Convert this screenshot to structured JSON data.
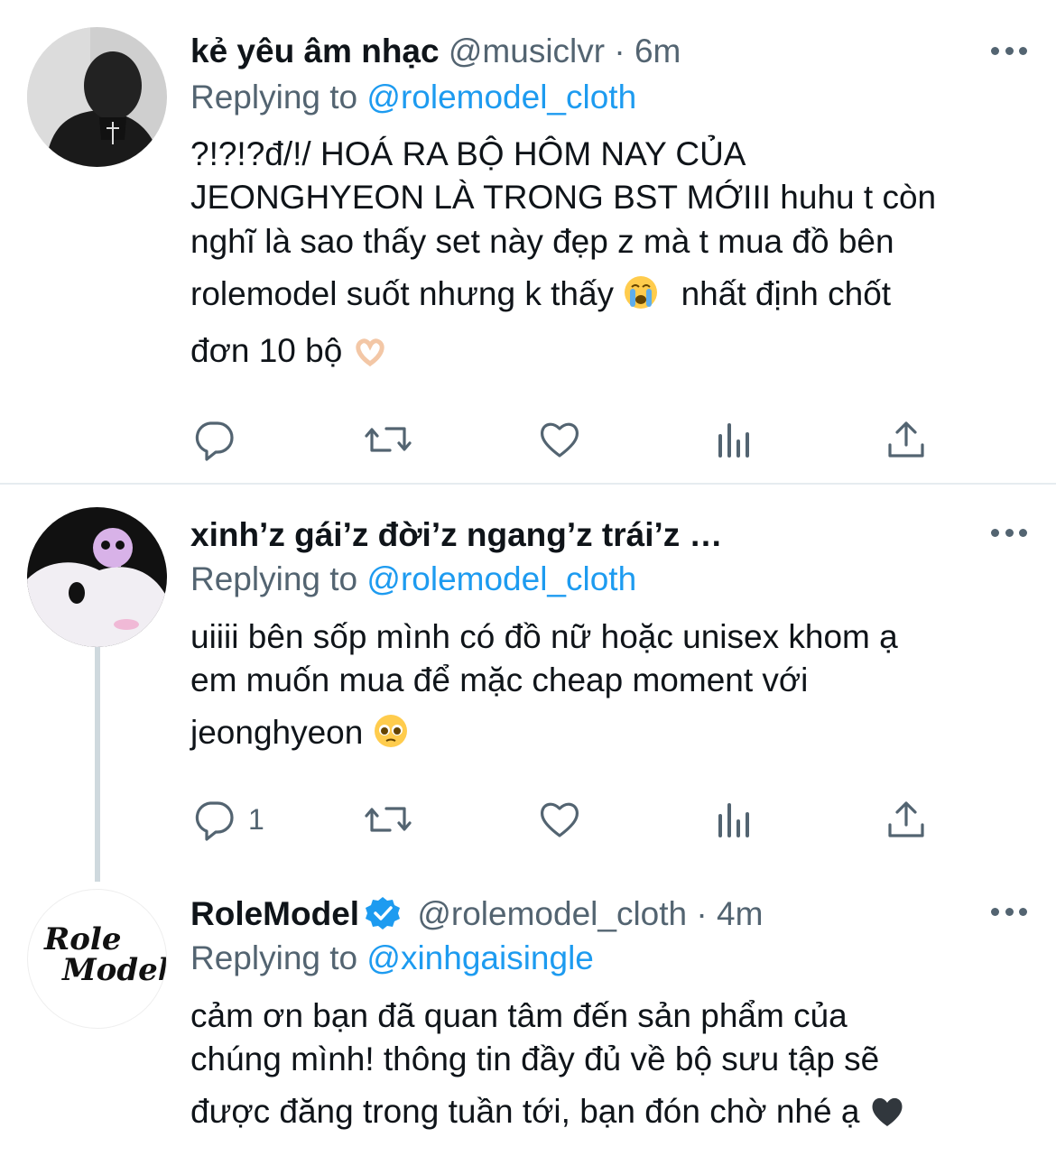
{
  "tweets": [
    {
      "name": "kẻ yêu âm nhạc",
      "handle": "@musiclvr · 6m",
      "replying_prefix": "Replying to",
      "replying_to": "@rolemodel_cloth",
      "lines": [
        "?!?!?đ/!/ HOÁ RA BỘ HÔM NAY CỦA",
        "JEONGHYEON LÀ TRONG BST MỚIII huhu t còn",
        "nghĩ là sao thấy set này đẹp z mà t mua đồ bên",
        "rolemodel suốt nhưng k thấy",
        "nhất định chốt",
        "đơn 10 bộ"
      ],
      "reply_count": ""
    },
    {
      "name": "xinh’z gái’z đời’z ngang’z trái’z …",
      "handle": "",
      "replying_prefix": "Replying to",
      "replying_to": "@rolemodel_cloth",
      "lines": [
        "uiiii bên sốp mình có đồ nữ hoặc unisex khom ạ",
        "em muốn mua để mặc cheap moment với",
        "jeonghyeon"
      ],
      "reply_count": "1"
    },
    {
      "name": "RoleModel",
      "handle": "@rolemodel_cloth · 4m",
      "replying_prefix": "Replying to",
      "replying_to": "@xinhgaisingle",
      "logo_text": [
        "Role",
        "Model"
      ],
      "lines": [
        "cảm ơn bạn đã quan tâm đến sản phẩm của",
        "chúng mình! thông tin đầy đủ về bộ sưu tập sẽ",
        "được đăng trong tuần tới, bạn đón chờ nhé ạ"
      ]
    }
  ],
  "icons": {
    "reply": "reply-icon",
    "retweet": "retweet-icon",
    "like": "heart-icon",
    "analytics": "analytics-icon",
    "share": "share-icon",
    "more": "more-icon",
    "verified": "verified-badge-icon"
  },
  "colors": {
    "accent": "#1d9bf0",
    "muted": "#536471",
    "text": "#0f1419"
  }
}
